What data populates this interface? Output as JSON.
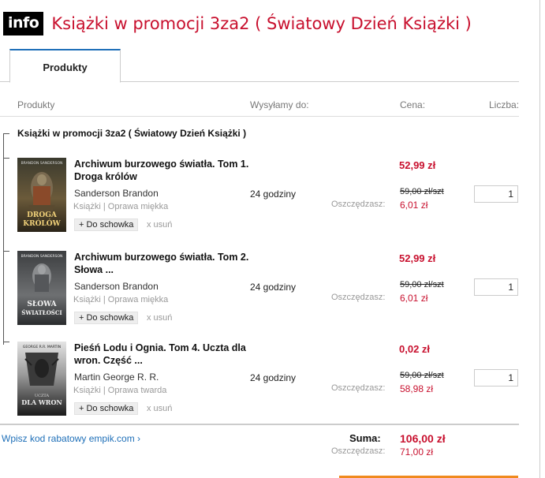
{
  "header": {
    "badge": "info",
    "title": "Książki w promocji 3za2 ( Światowy Dzień Książki )"
  },
  "tabs": [
    {
      "label": "Produkty"
    }
  ],
  "columns": {
    "products": "Produkty",
    "ships": "Wysyłamy do:",
    "price": "Cena:",
    "qty": "Liczba:"
  },
  "group": {
    "title": "Książki w promocji 3za2 ( Światowy Dzień Książki )"
  },
  "items": [
    {
      "title": "Archiwum burzowego światła. Tom 1. Droga królów",
      "author": "Sanderson Brandon",
      "binding": "Książki  | Oprawa miękka",
      "cover_author": "BRANDON SANDERSON",
      "cover_title": "DROGA KRÓLÓW",
      "delivery": "24 godziny",
      "price": "52,99 zł",
      "old_price": "59,00 zł/szt",
      "save_label": "Oszczędzasz:",
      "save": "6,01 zł",
      "qty": "1",
      "add_label": "+ Do schowka",
      "remove_label": "x usuń"
    },
    {
      "title": "Archiwum burzowego światła. Tom 2. Słowa ...",
      "author": "Sanderson Brandon",
      "binding": "Książki  | Oprawa miękka",
      "cover_author": "BRANDON SANDERSON",
      "cover_title": "SŁOWA ŚWIATŁOŚCI",
      "delivery": "24 godziny",
      "price": "52,99 zł",
      "old_price": "59,00 zł/szt",
      "save_label": "Oszczędzasz:",
      "save": "6,01 zł",
      "qty": "1",
      "add_label": "+ Do schowka",
      "remove_label": "x usuń"
    },
    {
      "title": "Pieśń Lodu i Ognia. Tom 4. Uczta dla wron. Część ...",
      "author": "Martin George R. R.",
      "binding": "Książki  | Oprawa twarda",
      "cover_author": "GEORGE R.R. MARTIN",
      "cover_title": "DLA WRON",
      "delivery": "24 godziny",
      "price": "0,02 zł",
      "old_price": "59,00 zł/szt",
      "save_label": "Oszczędzasz:",
      "save": "58,98 zł",
      "qty": "1",
      "add_label": "+ Do schowka",
      "remove_label": "x usuń"
    }
  ],
  "footer": {
    "promo_link": "Wpisz kod rabatowy empik.com ›",
    "sum_label": "Suma:",
    "sum_value": "106,00 zł",
    "save_label": "Oszczędzasz:",
    "save_value": "71,00 zł"
  },
  "colors": {
    "accent_red": "#c8102e",
    "link_blue": "#1e6fb8",
    "button_orange": "#f08a1e"
  }
}
